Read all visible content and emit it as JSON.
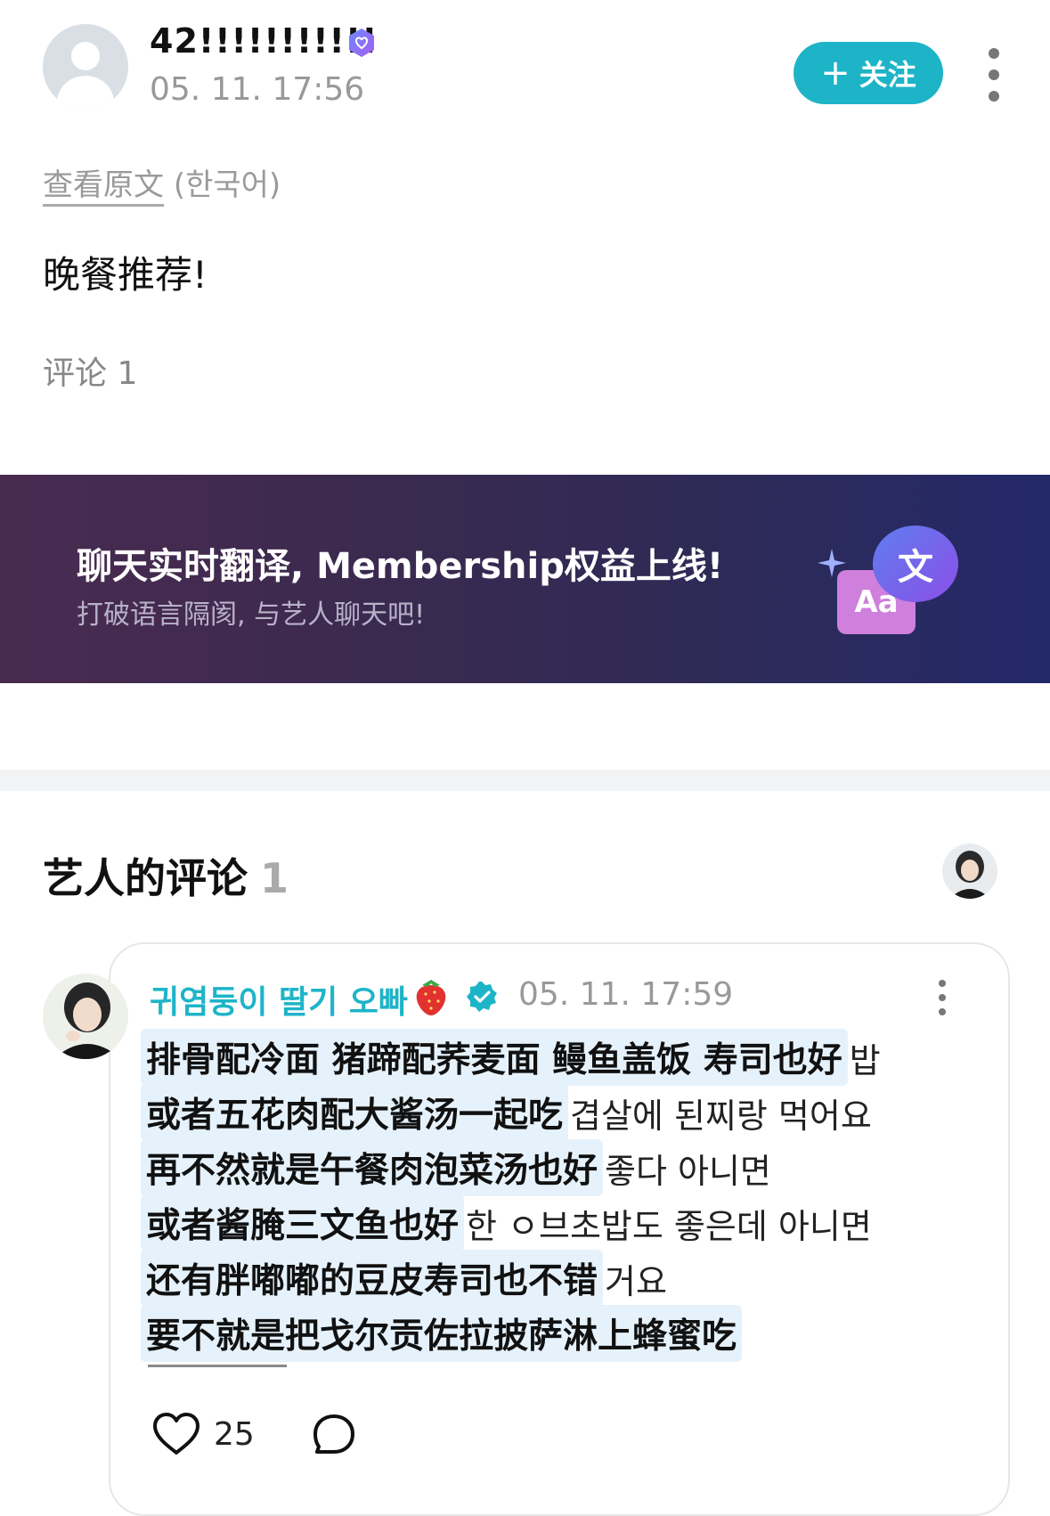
{
  "post": {
    "author_name": "42!!!!!!!!!!!",
    "date": "05. 11. 17:56",
    "follow_label": "关注",
    "view_original_label": "查看原文",
    "original_language": "(한국어)",
    "body": "晚餐推荐!",
    "comment_label": "评论",
    "comment_count": "1"
  },
  "banner": {
    "title": "聊天实时翻译, Membership权益上线!",
    "subtitle": "打破语言隔阂, 与艺人聊天吧!",
    "icon_aa": "Aa",
    "icon_wen": "文"
  },
  "artist_section": {
    "title": "艺人的评论",
    "count": "1"
  },
  "comment": {
    "author": "귀염둥이 딸기 오빠",
    "date": "05. 11. 17:59",
    "lines": [
      {
        "zh": "排骨配冷面 猪蹄配荞麦面 鳗鱼盖饭 寿司也好",
        "ko": "밥"
      },
      {
        "zh": "或者五花肉配大酱汤一起吃",
        "ko": "겹살에 된찌랑 먹어요"
      },
      {
        "zh": "再不然就是午餐肉泡菜汤也好",
        "ko": "좋다 아니면"
      },
      {
        "zh": "或者酱腌三文鱼也好",
        "ko": "한 ㅇ브초밥도 좋은데 아니면"
      },
      {
        "zh": "还有胖嘟嘟的豆皮寿司也不错",
        "ko": "거요"
      },
      {
        "zh": "要不就是把戈尔贡佐拉披萨淋上蜂蜜吃",
        "ko": ""
      }
    ],
    "like_count": "25"
  },
  "colors": {
    "accent": "#1eb4c8",
    "highlight": "#e6f2fb"
  }
}
